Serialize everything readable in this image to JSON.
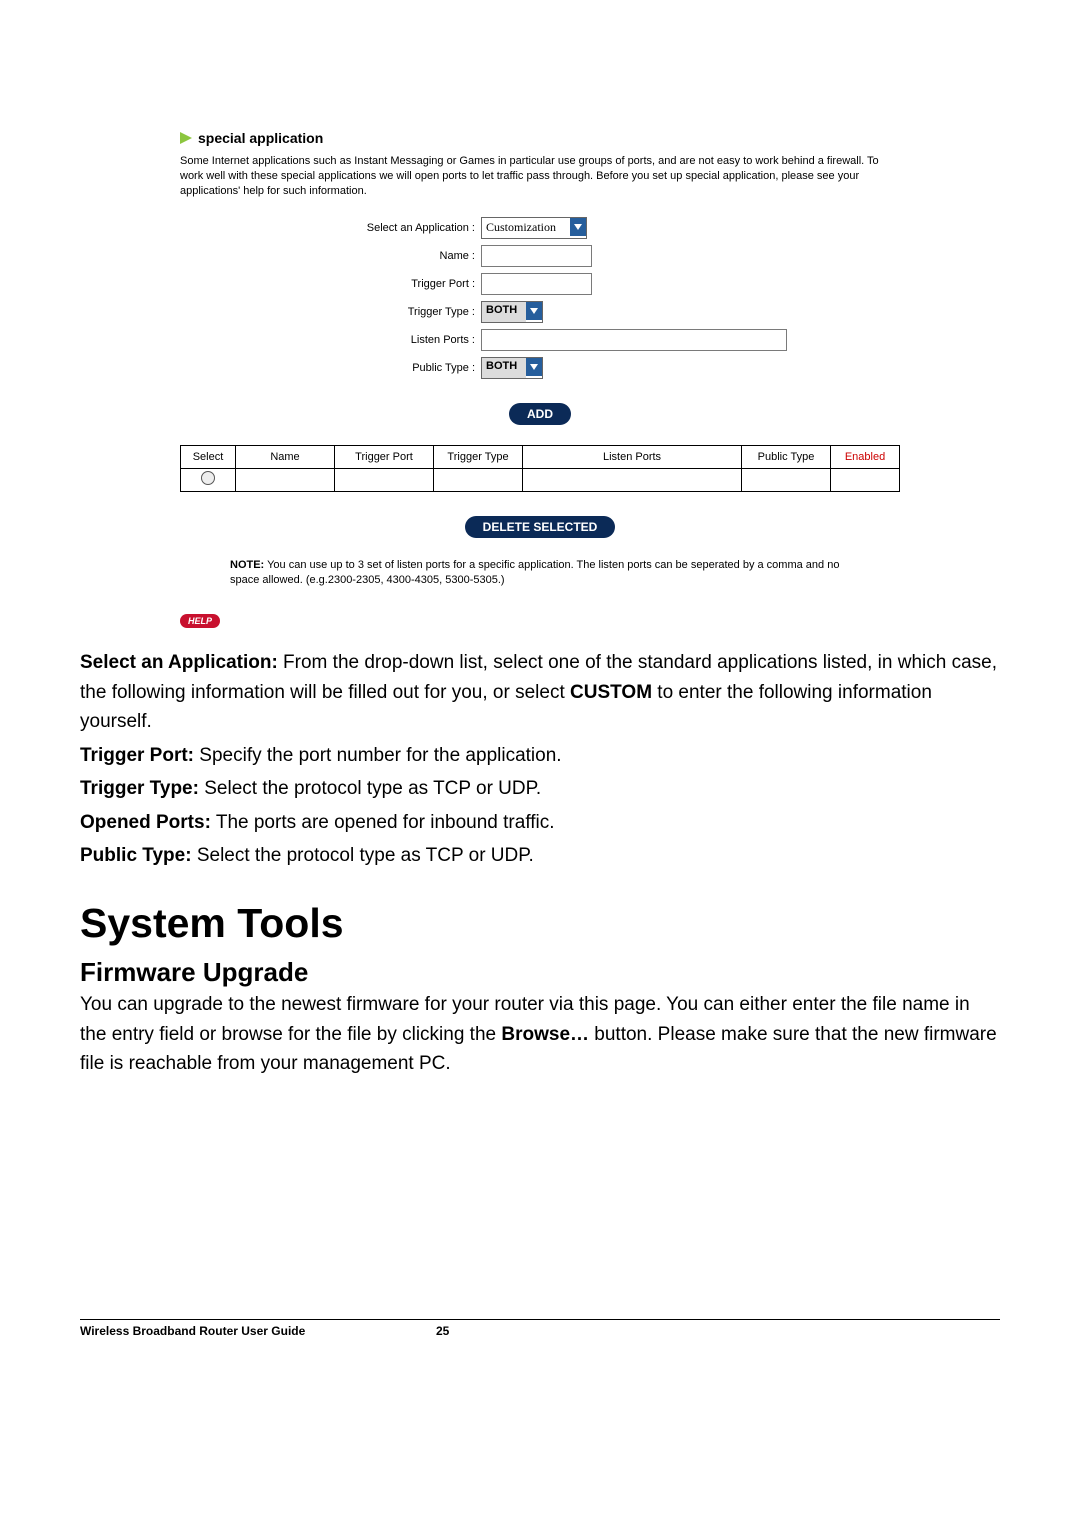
{
  "screenshot": {
    "header_title": "special application",
    "description": "Some Internet applications such as Instant Messaging or Games in particular use groups of ports, and are not easy to work behind a firewall. To work well with these special applications we will open ports to let traffic pass through. Before you set up special application, please see your applications' help for such information.",
    "fields": {
      "select_app_label": "Select an Application :",
      "select_app_value": "Customization",
      "name_label": "Name :",
      "name_value": "",
      "trigger_port_label": "Trigger Port :",
      "trigger_port_value": "",
      "trigger_type_label": "Trigger Type :",
      "trigger_type_value": "BOTH",
      "listen_ports_label": "Listen Ports :",
      "listen_ports_value": "",
      "public_type_label": "Public Type :",
      "public_type_value": "BOTH"
    },
    "buttons": {
      "add": "ADD",
      "delete": "DELETE SELECTED"
    },
    "table": {
      "headers": {
        "select": "Select",
        "name": "Name",
        "trigger_port": "Trigger Port",
        "trigger_type": "Trigger Type",
        "listen_ports": "Listen Ports",
        "public_type": "Public Type",
        "enabled": "Enabled"
      }
    },
    "note_label": "NOTE:",
    "note_text": " You can use up to 3 set of listen ports for a specific application. The listen ports can be seperated by a comma and no space allowed. (e.g.2300-2305, 4300-4305, 5300-5305.)",
    "help_label": "HELP"
  },
  "body": {
    "select_app_label": "Select an Application:",
    "select_app_text": " From the drop-down list, select one of the standard applications listed, in which case, the following information will be filled out for you, or select ",
    "custom_word": "CUSTOM",
    "select_app_text2": " to enter the following information yourself.",
    "trigger_port_label": "Trigger Port:",
    "trigger_port_text": " Specify the port number for the application.",
    "trigger_type_label": "Trigger Type:",
    "trigger_type_text": " Select the protocol type as TCP or UDP.",
    "opened_ports_label": "Opened Ports:",
    "opened_ports_text": " The ports are opened for inbound traffic.",
    "public_type_label": "Public Type:",
    "public_type_text": " Select the protocol type as TCP or UDP.",
    "h1": "System Tools",
    "h2": "Firmware Upgrade",
    "firmware_text1": "You can upgrade to the newest firmware for your router via this page. You can either enter the file name in the entry field or browse for the file by clicking the ",
    "browse_word": "Browse…",
    "firmware_text2": " button. Please make sure that the new firmware file is reachable from your management PC."
  },
  "footer": {
    "left": "Wireless Broadband Router User Guide",
    "right": "25"
  }
}
